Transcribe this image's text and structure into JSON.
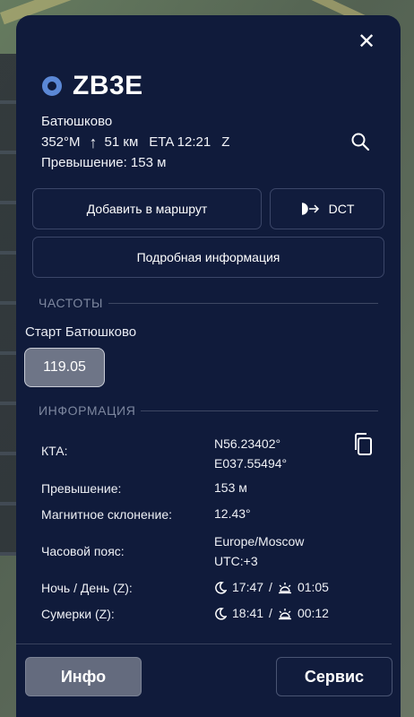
{
  "waypoint": {
    "name": "ZB3E",
    "place": "Батюшково",
    "bearing": "352°M",
    "distance": "51 км",
    "eta": "ETA 12:21",
    "eta_zone": "Z",
    "elevation_line": "Превышение: 153 м"
  },
  "actions": {
    "add_route": "Добавить в маршрут",
    "dct": "DCT",
    "details": "Подробная информация"
  },
  "frequencies": {
    "section_title": "ЧАСТОТЫ",
    "station": "Старт Батюшково",
    "value": "119.05"
  },
  "info": {
    "section_title": "ИНФОРМАЦИЯ",
    "kta_label": "КТА:",
    "kta_lat": "N56.23402°",
    "kta_lon": "E037.55494°",
    "elev_label": "Превышение:",
    "elev_value": "153 м",
    "magvar_label": "Магнитное склонение:",
    "magvar_value": "12.43°",
    "tz_label": "Часовой пояс:",
    "tz_name": "Europe/Moscow",
    "tz_offset": "UTC:+3",
    "night_label": "Ночь / День (Z):",
    "night_value": "17:47",
    "day_value": "01:05",
    "twilight_label": "Сумерки  (Z):",
    "twilight_dusk": "18:41",
    "twilight_dawn": "00:12",
    "separator": "/"
  },
  "tabs": {
    "info": "Инфо",
    "service": "Сервис"
  },
  "icons": {
    "close": "close-icon",
    "search": "search-icon",
    "copy": "copy-icon",
    "moon": "moon-icon",
    "sun": "sun-icon",
    "dct": "dct-icon",
    "arrow": "arrow-up-icon"
  },
  "colors": {
    "panel": "#101b3b",
    "accent": "#5b88d6",
    "chip": "#6e7587"
  }
}
